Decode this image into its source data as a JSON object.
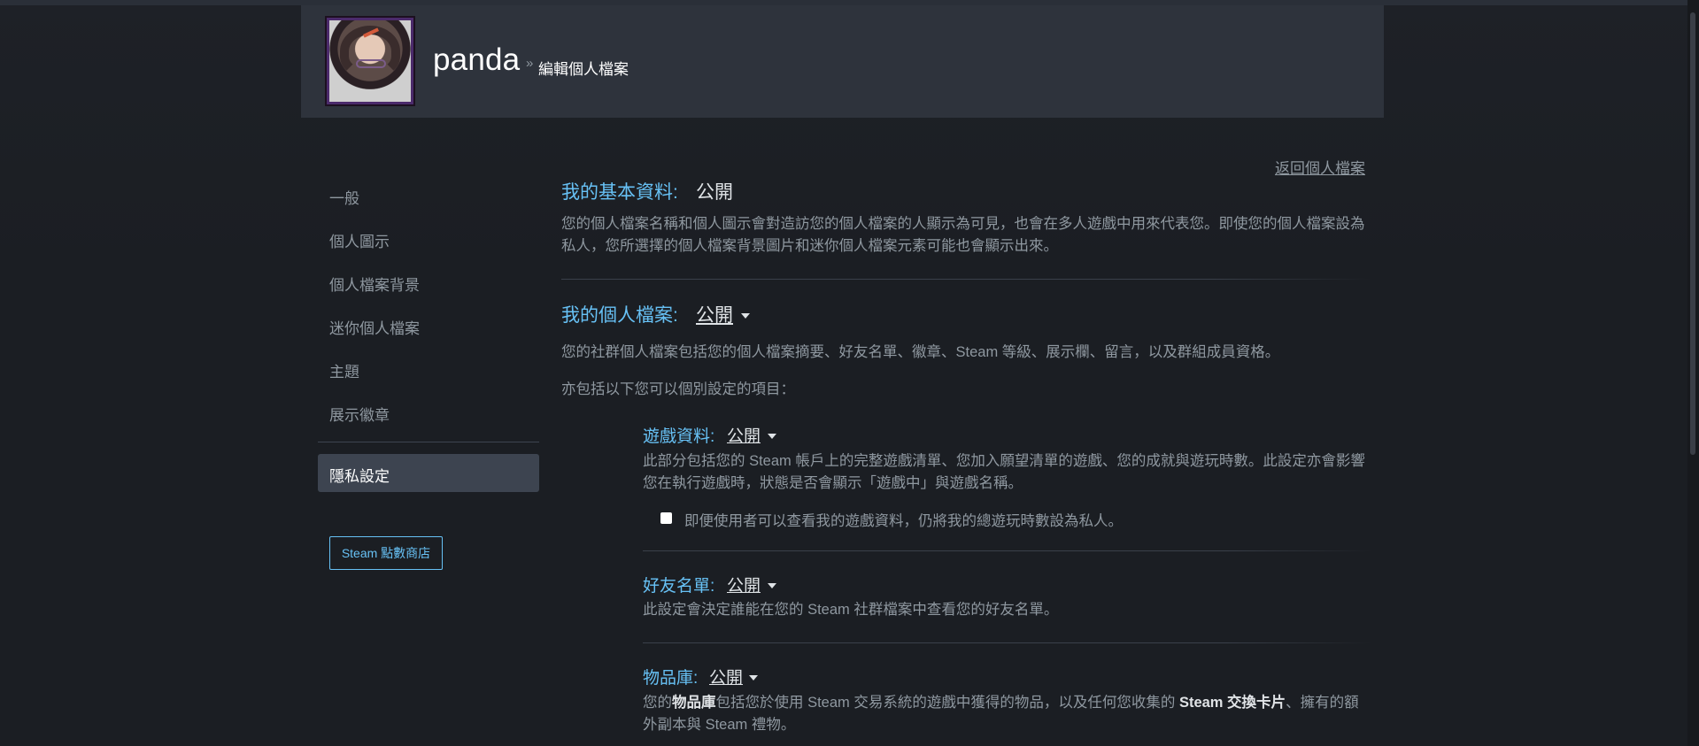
{
  "header": {
    "persona_name": "panda",
    "breadcrumb_separator": "»",
    "page_title": "編輯個人檔案"
  },
  "sidebar": {
    "items": [
      {
        "label": "一般"
      },
      {
        "label": "個人圖示"
      },
      {
        "label": "個人檔案背景"
      },
      {
        "label": "迷你個人檔案"
      },
      {
        "label": "主題"
      },
      {
        "label": "展示徽章"
      }
    ],
    "active_item": "隱私設定",
    "points_shop_button": "Steam 點數商店"
  },
  "main": {
    "back_link": "返回個人檔案",
    "basic_info": {
      "label": "我的基本資料:",
      "value": "公開",
      "description": "您的個人檔案名稱和個人圖示會對造訪您的個人檔案的人顯示為可見，也會在多人遊戲中用來代表您。即使您的個人檔案設為私人，您所選擇的個人檔案背景圖片和迷你個人檔案元素可能也會顯示出來。"
    },
    "profile": {
      "label": "我的個人檔案:",
      "value": "公開",
      "description": "您的社群個人檔案包括您的個人檔案摘要、好友名單、徽章、Steam 等級、展示欄、留言，以及群組成員資格。",
      "also_includes": "亦包括以下您可以個別設定的項目："
    },
    "game_details": {
      "label": "遊戲資料:",
      "value": "公開",
      "description": "此部分包括您的 Steam 帳戶上的完整遊戲清單、您加入願望清單的遊戲、您的成就與遊玩時數。此設定亦會影響您在執行遊戲時，狀態是否會顯示「遊戲中」與遊戲名稱。",
      "checkbox_label": "即便使用者可以查看我的遊戲資料，仍將我的總遊玩時數設為私人。",
      "checkbox_checked": false
    },
    "friends_list": {
      "label": "好友名單:",
      "value": "公開",
      "description": "此設定會決定誰能在您的 Steam 社群檔案中查看您的好友名單。"
    },
    "inventory": {
      "label": "物品庫:",
      "value": "公開",
      "desc_part1": "您的",
      "desc_bold1": "物品庫",
      "desc_part2": "包括您於使用 Steam 交易系統的遊戲中獲得的物品，以及任何您收集的 ",
      "desc_bold2": "Steam 交換卡片",
      "desc_part3": "、擁有的額外副本與 Steam 禮物。"
    }
  },
  "colors": {
    "accent_blue": "#67c1f5",
    "text_muted": "#8f98a0",
    "background": "#1b1e23",
    "header_bg": "#2e333c",
    "active_nav_bg": "#3d4450"
  }
}
